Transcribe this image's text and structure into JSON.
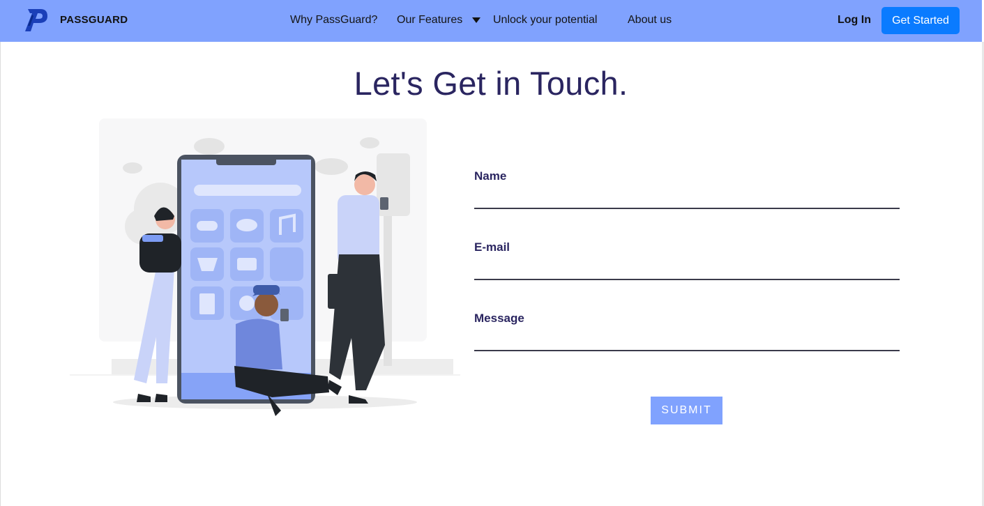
{
  "nav": {
    "brand": "PASSGUARD",
    "links": [
      "Why PassGuard?",
      "Our Features",
      "Unlock your potential",
      "About us"
    ],
    "login": "Log In",
    "cta": "Get Started"
  },
  "main": {
    "heading": "Let's Get in Touch.",
    "form": {
      "name_label": "Name",
      "email_label": "E-mail",
      "message_label": "Message",
      "submit_label": "SUBMIT"
    }
  },
  "colors": {
    "nav_bg": "#80a2fe",
    "cta_bg": "#0a7bff",
    "heading": "#2a2560",
    "submit_bg": "#80a2fe"
  },
  "icons": [
    "passguard-logo-icon",
    "chevron-down-icon"
  ]
}
